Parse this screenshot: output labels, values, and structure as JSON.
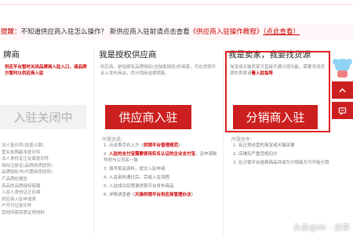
{
  "notice": {
    "mark": "提醒：",
    "question": "不知道供应商入驻怎么操作？",
    "before_link": "新供应商入驻前请点击查看",
    "link_text": "《供应商入驻操作教程》",
    "after_link": "（点此查看）"
  },
  "columns": [
    {
      "title": "牌商",
      "desc_red": "供应平台暂时关闭品牌商入驻入口，请品牌方暂时以供应商入驻",
      "desc": "",
      "button": "入驻关闭中",
      "list": [
        "法人复印件(加盖公章)",
        "营业执照副本复印件",
        "法人身份证正反面复印件",
        "商标注册证(品牌商须提供)",
        "品牌授权书(代理商须提供)",
        "产品质检报告",
        "商品的品牌授权链路",
        "入驻人身份证正反面",
        "供应商入驻申请表",
        "户开可证复印件",
        "其他所需资质证明材料"
      ]
    },
    {
      "title": "我是授权供应商",
      "desc": "供应商，是指拥有品牌授权(含独家授权)的商家，可在供销平台上发布商品，供分销商选择销售。",
      "button": "供应商入驻",
      "section_head": "所需资质：",
      "steps": [
        {
          "text": "1. 点击首页右上方《供销平台管理规范》",
          "red": "供销平台管理规范"
        },
        {
          "text": "2. 入驻的支付宝需要使用实名认证的企业支付宝，且申请账号时与公司名一致",
          "red": "入驻的支付宝需要使用实名认证的企业支付宝"
        },
        {
          "text": "3. 填写相关资料，提交入驻申请",
          "red": ""
        },
        {
          "text": "4. 入驻审核通过后，完成入驻流程",
          "red": ""
        },
        {
          "text": "5. 入驻成功后登录供销平台发布商品",
          "red": ""
        },
        {
          "text": "6. 详情请查看《天猫供销平台供应商管理办法》",
          "red": "天猫供销平台供应商管理办法"
        }
      ]
    },
    {
      "title": "我是卖家，我要找货源",
      "desc": "淘宝或天猫卖家可直接开通分销功能，需要寻找货源的卖家请",
      "desc_red": "看入驻指导",
      "button": "分销商入驻",
      "section_head": "所需条件：",
      "steps": [
        {
          "text": "1. 有正常经营的淘宝或天猫店铺",
          "red": ""
        },
        {
          "text": "2. 店铺无严重违规扣分",
          "red": ""
        },
        {
          "text": "3. 在分销平台选择商品并成为分销商方可开始分销",
          "red": ""
        }
      ]
    }
  ],
  "side_tools": {
    "mascot": "mascot-icon",
    "top": "chevron-up-icon",
    "feedback": "message-icon"
  },
  "watermark": "头条@Mr · 白茶",
  "colors": {
    "brand_red": "#cc1f1f",
    "highlight_red": "#e02020",
    "disabled_bg": "#f2f2f2"
  }
}
